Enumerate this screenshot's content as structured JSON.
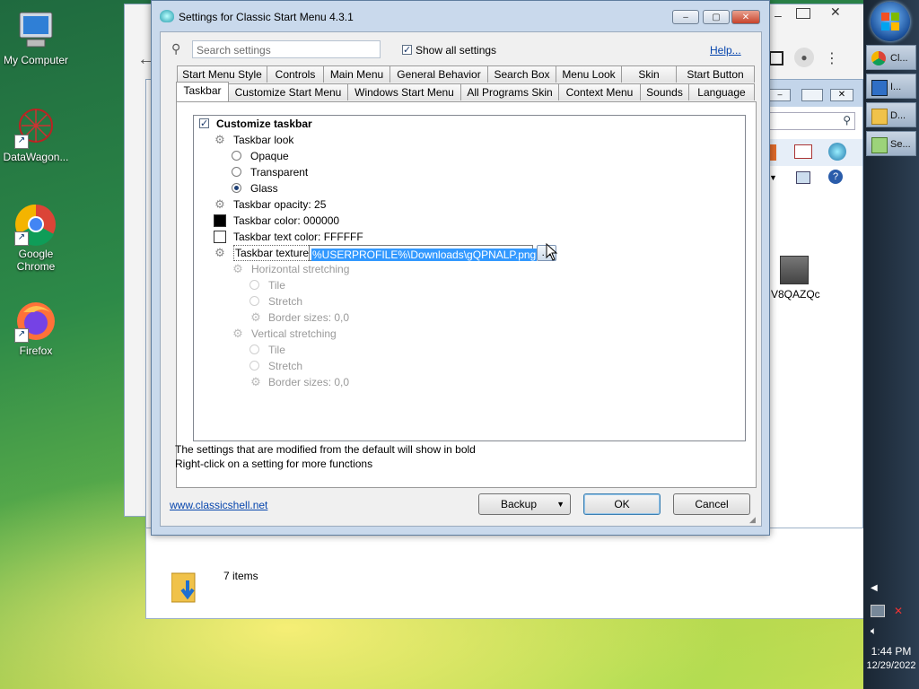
{
  "desktop": {
    "icons": [
      {
        "label": "My Computer"
      },
      {
        "label": "DataWagon..."
      },
      {
        "label": "Google Chrome"
      },
      {
        "label": "Firefox"
      }
    ],
    "file_label": "V8QAZQc"
  },
  "taskbar": {
    "buttons": [
      {
        "label": "Cl..."
      },
      {
        "label": "I..."
      },
      {
        "label": "D..."
      },
      {
        "label": "Se..."
      }
    ],
    "time": "1:44 PM",
    "date": "12/29/2022"
  },
  "explorer": {
    "status": "7 items"
  },
  "dialog": {
    "title": "Settings for Classic Start Menu 4.3.1",
    "search_placeholder": "Search settings",
    "show_all_label": "Show all settings",
    "help_link": "Help...",
    "tabs_row1": [
      "Start Menu Style",
      "Controls",
      "Main Menu",
      "General Behavior",
      "Search Box",
      "Menu Look",
      "Skin",
      "Start Button"
    ],
    "tabs_row2": [
      "Taskbar",
      "Customize Start Menu",
      "Windows Start Menu",
      "All Programs Skin",
      "Context Menu",
      "Sounds",
      "Language"
    ],
    "tree": {
      "customize_taskbar": "Customize taskbar",
      "taskbar_look": "Taskbar look",
      "opaque": "Opaque",
      "transparent": "Transparent",
      "glass": "Glass",
      "opacity": "Taskbar opacity: 25",
      "color": "Taskbar color: 000000",
      "text_color": "Taskbar text color: FFFFFF",
      "texture": "Taskbar texture",
      "texture_value": "%USERPROFILE%\\Downloads\\gQPNALP.png",
      "h_stretch": "Horizontal stretching",
      "h_tile": "Tile",
      "h_stretch_opt": "Stretch",
      "h_border": "Border sizes: 0,0",
      "v_stretch": "Vertical stretching",
      "v_tile": "Tile",
      "v_stretch_opt": "Stretch",
      "v_border": "Border sizes: 0,0"
    },
    "note1": "The settings that are modified from the default will show in bold",
    "note2": "Right-click on a setting for more functions",
    "website": "www.classicshell.net",
    "backup_label": "Backup",
    "ok_label": "OK",
    "cancel_label": "Cancel"
  }
}
